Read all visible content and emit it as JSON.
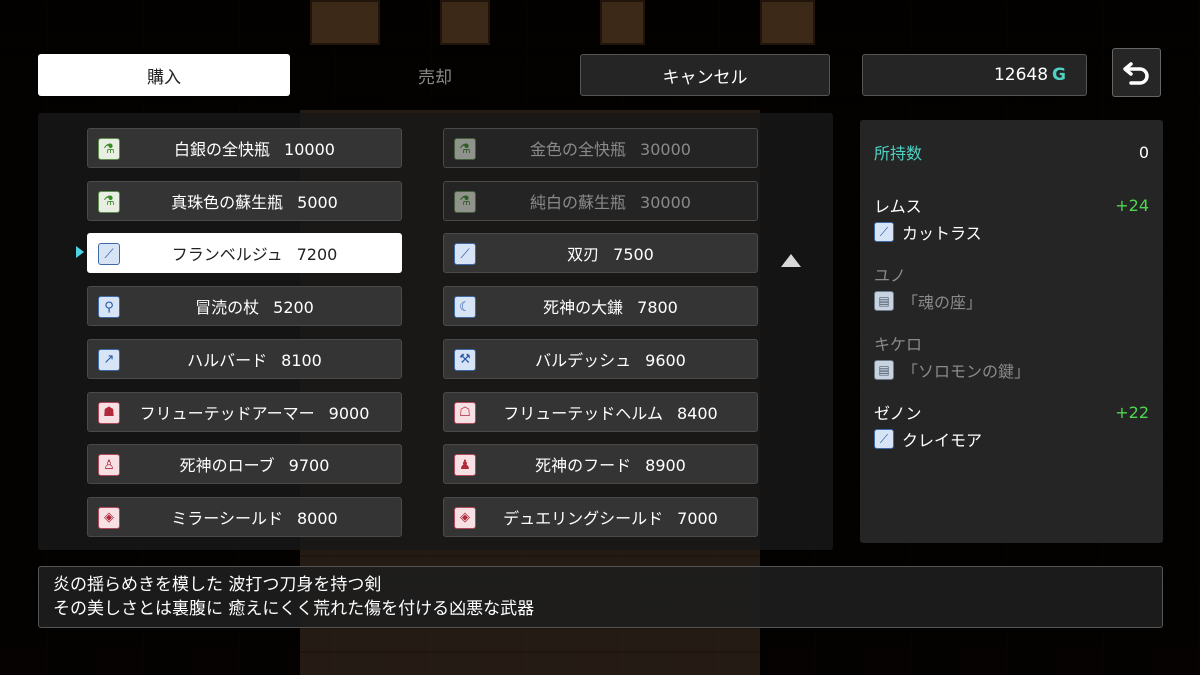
{
  "tabs": {
    "buy": "購入",
    "sell": "売却",
    "cancel": "キャンセル"
  },
  "gold": {
    "amount": "12648",
    "unit": "G"
  },
  "back_icon": "undo-arrow-icon",
  "items_left": [
    {
      "name": "白銀の全快瓶",
      "price": "10000",
      "icon": "potion-icon",
      "state": "normal"
    },
    {
      "name": "真珠色の蘇生瓶",
      "price": "5000",
      "icon": "potion-icon",
      "state": "normal"
    },
    {
      "name": "フランベルジュ",
      "price": "7200",
      "icon": "sword-icon",
      "state": "selected"
    },
    {
      "name": "冒涜の杖",
      "price": "5200",
      "icon": "staff-icon",
      "state": "normal"
    },
    {
      "name": "ハルバード",
      "price": "8100",
      "icon": "spear-icon",
      "state": "normal"
    },
    {
      "name": "フリューテッドアーマー",
      "price": "9000",
      "icon": "armor-icon",
      "state": "normal"
    },
    {
      "name": "死神のローブ",
      "price": "9700",
      "icon": "robe-icon",
      "state": "normal"
    },
    {
      "name": "ミラーシールド",
      "price": "8000",
      "icon": "shield-icon",
      "state": "normal"
    }
  ],
  "items_right": [
    {
      "name": "金色の全快瓶",
      "price": "30000",
      "icon": "potion-icon",
      "state": "disabled"
    },
    {
      "name": "純白の蘇生瓶",
      "price": "30000",
      "icon": "potion-icon",
      "state": "disabled"
    },
    {
      "name": "双刃",
      "price": "7500",
      "icon": "sword-icon",
      "state": "normal"
    },
    {
      "name": "死神の大鎌",
      "price": "7800",
      "icon": "scythe-icon",
      "state": "normal"
    },
    {
      "name": "バルデッシュ",
      "price": "9600",
      "icon": "axe-icon",
      "state": "normal"
    },
    {
      "name": "フリューテッドヘルム",
      "price": "8400",
      "icon": "helm-icon",
      "state": "normal"
    },
    {
      "name": "死神のフード",
      "price": "8900",
      "icon": "hood-icon",
      "state": "normal"
    },
    {
      "name": "デュエリングシールド",
      "price": "7000",
      "icon": "shield-icon",
      "state": "normal"
    }
  ],
  "info": {
    "owned_label": "所持数",
    "owned_count": "0",
    "members": [
      {
        "name": "レムス",
        "bonus": "+24",
        "equip": "カットラス",
        "equip_icon": "sword-icon",
        "dim": false
      },
      {
        "name": "ユノ",
        "bonus": "",
        "equip": "「魂の座」",
        "equip_icon": "book-icon",
        "dim": true
      },
      {
        "name": "キケロ",
        "bonus": "",
        "equip": "「ソロモンの鍵」",
        "equip_icon": "book-icon",
        "dim": true
      },
      {
        "name": "ゼノン",
        "bonus": "+22",
        "equip": "クレイモア",
        "equip_icon": "sword-icon",
        "dim": false
      }
    ]
  },
  "description": {
    "line1": "炎の揺らめきを模した 波打つ刀身を持つ剣",
    "line2": "その美しさとは裏腹に 癒えにくく荒れた傷を付ける凶悪な武器"
  },
  "colors": {
    "accent": "#4fd2c2",
    "bonus": "#4ed84e",
    "cursor": "#4fd2e2"
  }
}
